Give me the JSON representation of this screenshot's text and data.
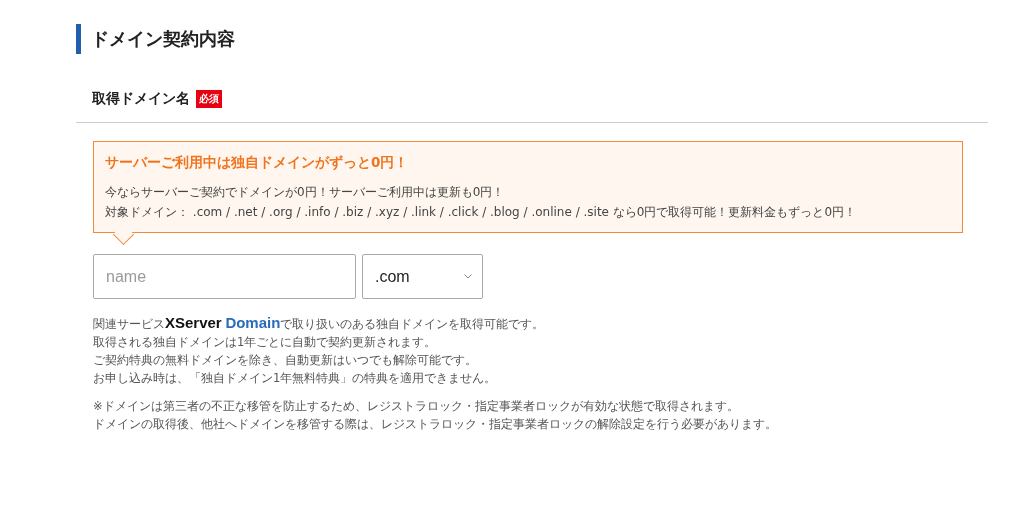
{
  "section_title": "ドメイン契約内容",
  "field": {
    "label": "取得ドメイン名",
    "required_badge": "必須"
  },
  "notice": {
    "title": "サーバーご利用中は独自ドメインがずっと0円！",
    "lines": [
      "今ならサーバーご契約でドメインが0円！サーバーご利用中は更新も0円！",
      "対象ドメイン： .com / .net / .org / .info / .biz / .xyz / .link / .click / .blog / .online / .site なら0円で取得可能！更新料金もずっと0円！"
    ]
  },
  "name_input": {
    "placeholder": "name"
  },
  "tld_select": {
    "value": ".com"
  },
  "related_service": {
    "prefix": "関連サービス",
    "logo_main": "XServer",
    "logo_accent": "Domain",
    "suffix": "で取り扱いのある独自ドメインを取得可能です。"
  },
  "notes": [
    "取得される独自ドメインは1年ごとに自動で契約更新されます。",
    "ご契約特典の無料ドメインを除き、自動更新はいつでも解除可能です。",
    "お申し込み時は、「独自ドメイン1年無料特典」の特典を適用できません。"
  ],
  "cautions": [
    "※ドメインは第三者の不正な移管を防止するため、レジストラロック・指定事業者ロックが有効な状態で取得されます。",
    "ドメインの取得後、他社へドメインを移管する際は、レジストラロック・指定事業者ロックの解除設定を行う必要があります。"
  ]
}
